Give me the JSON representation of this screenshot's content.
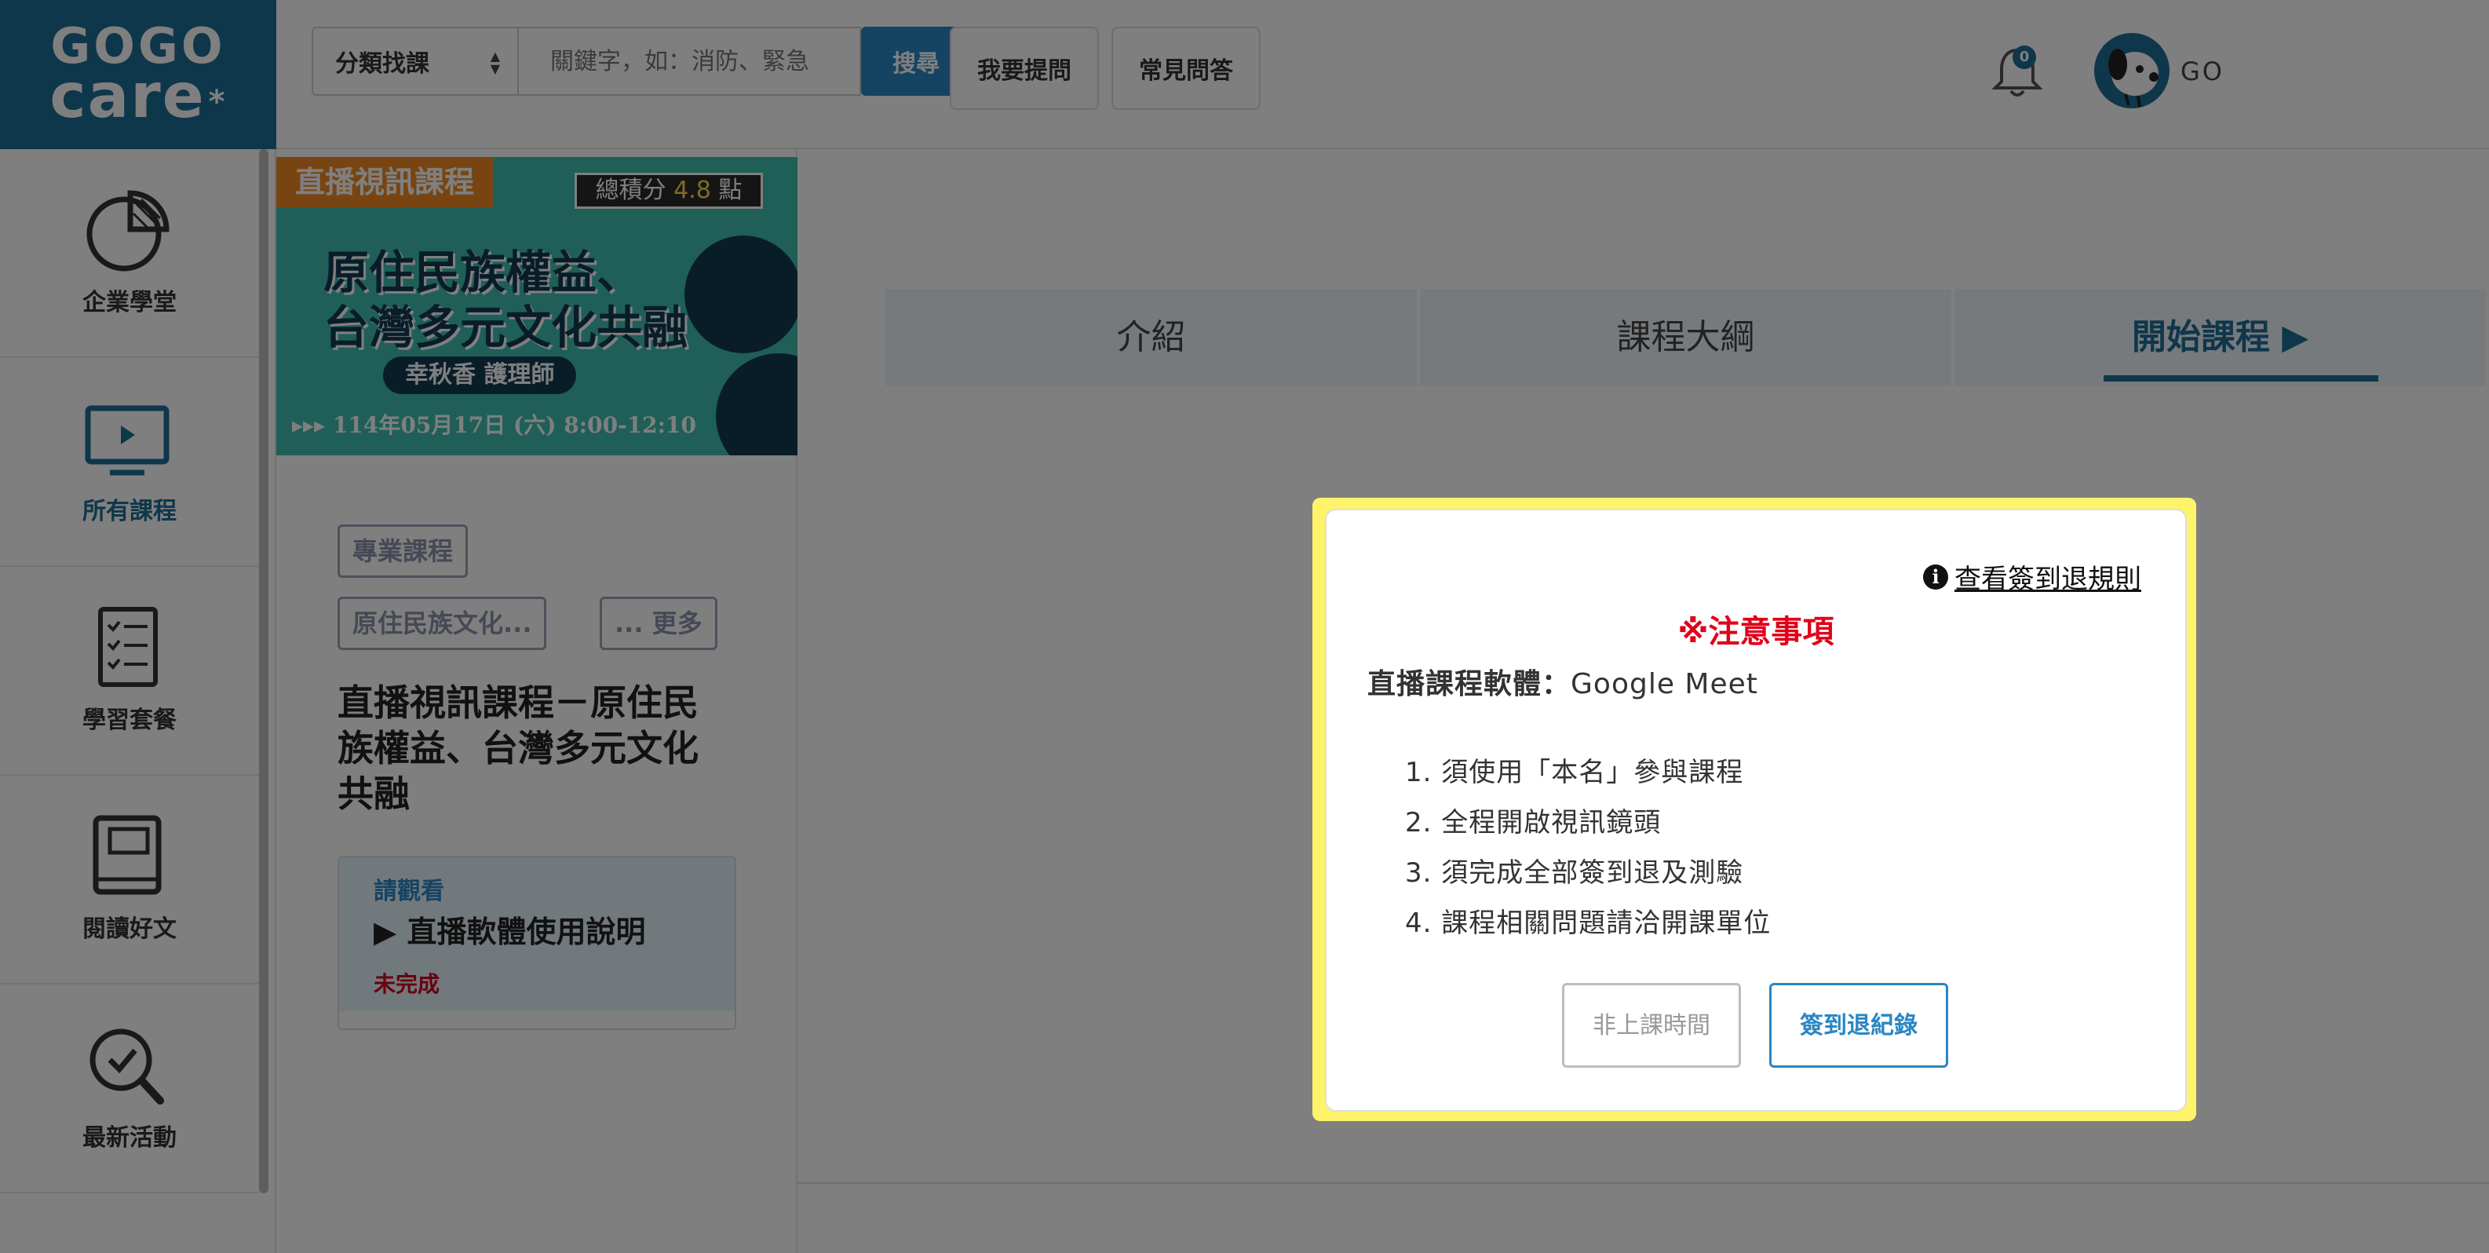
{
  "logo": {
    "line1": "GOGO",
    "line2": "care",
    "mark": "*"
  },
  "search": {
    "category_label": "分類找課",
    "placeholder": "關鍵字，如：消防、緊急",
    "button_label": "搜尋"
  },
  "header": {
    "ask_label": "我要提問",
    "faq_label": "常見問答",
    "notification_count": "0",
    "user_name": "GO"
  },
  "sidebar": {
    "items": [
      {
        "label": "企業學堂",
        "icon": "pie-chart-icon"
      },
      {
        "label": "所有課程",
        "icon": "monitor-icon"
      },
      {
        "label": "學習套餐",
        "icon": "checklist-icon"
      },
      {
        "label": "閱讀好文",
        "icon": "book-icon"
      },
      {
        "label": "最新活動",
        "icon": "magnifier-check-icon"
      }
    ]
  },
  "course": {
    "banner": {
      "tag": "直播視訊課程",
      "score_prefix": "總積分",
      "score_value": "4.8",
      "score_unit": "點",
      "title_line1": "原住民族權益、",
      "title_line2": "台灣多元文化共融",
      "teacher": "幸秋香 護理師",
      "date": "▸▸▸ 114年05月17日 (六) 8:00-12:10"
    },
    "chips": [
      "專業課程",
      "原住民族文化...",
      "... 更多"
    ],
    "title": "直播視訊課程－原住民族權益、台灣多元文化共融",
    "watch": {
      "hint": "請觀看",
      "name": "▶ 直播軟體使用說明",
      "status": "未完成"
    }
  },
  "tabs": [
    {
      "label": "介紹"
    },
    {
      "label": "課程大綱"
    },
    {
      "label": "開始課程 ▶"
    }
  ],
  "modal": {
    "rules_link": "查看簽到退規則",
    "notice": "※注意事項",
    "software_label": "直播課程軟體：",
    "software_value": "Google Meet",
    "rules": [
      "1. 須使用「本名」參與課程",
      "2. 全程開啟視訊鏡頭",
      "3. 須完成全部簽到退及測驗",
      "4. 課程相關問題請洽開課單位"
    ],
    "btn_off": "非上課時間",
    "btn_record": "簽到退紀錄"
  },
  "colors": {
    "brand": "#1f6f97",
    "accent": "#2a86c4",
    "warning": "#e0001b",
    "highlight": "#fff36b"
  }
}
